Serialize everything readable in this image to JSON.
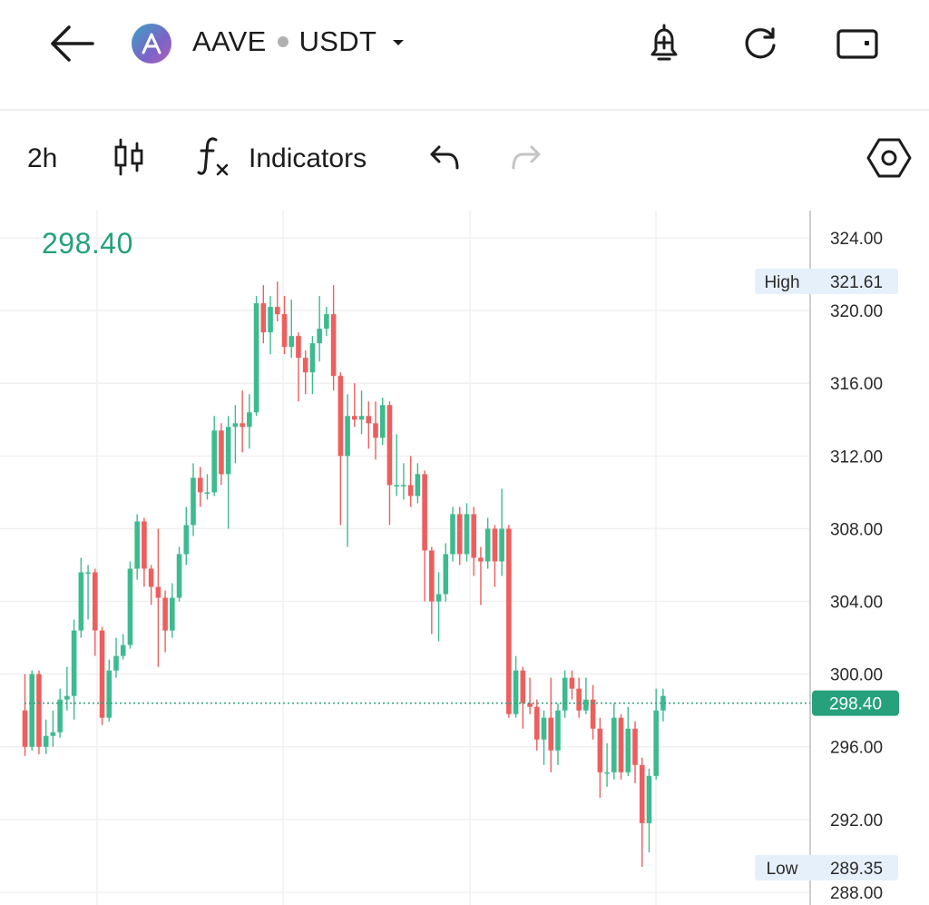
{
  "header": {
    "base": "AAVE",
    "quote": "USDT",
    "icons": [
      "back-arrow-icon",
      "aave-logo-icon",
      "caret-down-icon",
      "price-alert-bell-icon",
      "refresh-icon",
      "wallet-icon"
    ]
  },
  "toolbar": {
    "timeframe": "2h",
    "indicators_label": "Indicators",
    "icons": [
      "candlestick-type-icon",
      "fx-indicators-icon",
      "undo-icon",
      "redo-icon",
      "settings-hexagon-icon"
    ]
  },
  "last_price": "298.40",
  "colors": {
    "up": "#3dbb8f",
    "down": "#ee5e5e",
    "accent": "#26a17b",
    "badge_bg": "#e6f0fb"
  },
  "chart_data": {
    "type": "candlestick",
    "yticks": [
      "324.00",
      "320.00",
      "316.00",
      "312.00",
      "308.00",
      "304.00",
      "300.00",
      "296.00",
      "292.00",
      "288.00"
    ],
    "ylim": [
      286.4,
      324.6
    ],
    "grid": true,
    "high": {
      "label": "High",
      "value": "321.61"
    },
    "low": {
      "label": "Low",
      "value": "289.35"
    },
    "last": {
      "value": "298.40"
    },
    "candles": [
      [
        298.0,
        296.0,
        300.0,
        295.5
      ],
      [
        296.0,
        300.0,
        300.2,
        295.8
      ],
      [
        300.0,
        296.0,
        300.2,
        295.6
      ],
      [
        296.0,
        296.6,
        297.5,
        295.6
      ],
      [
        296.6,
        296.8,
        298.0,
        296.0
      ],
      [
        296.8,
        298.6,
        299.2,
        296.5
      ],
      [
        298.6,
        298.8,
        300.4,
        298.0
      ],
      [
        298.8,
        302.4,
        303.0,
        297.5
      ],
      [
        302.4,
        305.6,
        306.4,
        302.0
      ],
      [
        305.6,
        305.6,
        306.0,
        303.0
      ],
      [
        305.6,
        302.4,
        305.8,
        301.0
      ],
      [
        302.4,
        297.6,
        302.6,
        297.2
      ],
      [
        297.6,
        300.2,
        300.8,
        297.4
      ],
      [
        300.2,
        301.0,
        302.0,
        299.8
      ],
      [
        301.0,
        301.6,
        302.2,
        300.8
      ],
      [
        301.6,
        305.8,
        306.2,
        301.4
      ],
      [
        305.8,
        308.4,
        308.8,
        305.2
      ],
      [
        308.4,
        305.8,
        308.6,
        304.8
      ],
      [
        305.8,
        304.8,
        306.0,
        303.8
      ],
      [
        304.8,
        304.2,
        308.0,
        300.4
      ],
      [
        304.2,
        302.4,
        304.6,
        301.2
      ],
      [
        302.4,
        304.2,
        305.0,
        302.0
      ],
      [
        304.2,
        306.6,
        307.0,
        304.0
      ],
      [
        306.6,
        308.2,
        309.2,
        306.0
      ],
      [
        308.2,
        310.8,
        311.6,
        307.6
      ],
      [
        310.8,
        310.0,
        311.4,
        309.2
      ],
      [
        310.0,
        310.0,
        311.0,
        309.6
      ],
      [
        310.0,
        313.4,
        314.2,
        309.8
      ],
      [
        313.4,
        311.0,
        313.8,
        310.4
      ],
      [
        311.0,
        313.6,
        314.2,
        308.0
      ],
      [
        313.6,
        313.8,
        314.8,
        311.6
      ],
      [
        313.8,
        313.6,
        315.6,
        312.2
      ],
      [
        313.6,
        314.4,
        315.4,
        312.4
      ],
      [
        314.4,
        320.4,
        320.8,
        314.2
      ],
      [
        320.4,
        318.8,
        321.4,
        318.2
      ],
      [
        318.8,
        320.2,
        320.8,
        317.6
      ],
      [
        320.2,
        319.8,
        321.6,
        319.4
      ],
      [
        319.8,
        318.0,
        320.8,
        317.6
      ],
      [
        318.0,
        318.6,
        320.6,
        317.4
      ],
      [
        318.6,
        317.4,
        318.8,
        315.0
      ],
      [
        317.4,
        316.6,
        317.8,
        315.4
      ],
      [
        316.6,
        318.2,
        318.6,
        315.4
      ],
      [
        318.2,
        319.0,
        320.8,
        317.2
      ],
      [
        319.0,
        319.8,
        320.2,
        318.6
      ],
      [
        319.8,
        316.4,
        321.4,
        315.6
      ],
      [
        316.4,
        312.0,
        316.6,
        308.2
      ],
      [
        312.0,
        314.2,
        315.4,
        307.0
      ],
      [
        314.2,
        314.0,
        316.0,
        313.6
      ],
      [
        314.0,
        314.2,
        315.6,
        313.2
      ],
      [
        314.2,
        313.8,
        315.0,
        312.4
      ],
      [
        313.8,
        313.0,
        315.0,
        311.8
      ],
      [
        313.0,
        314.8,
        315.2,
        312.6
      ],
      [
        314.8,
        310.4,
        315.0,
        308.2
      ],
      [
        310.4,
        310.4,
        313.2,
        309.8
      ],
      [
        310.4,
        310.4,
        311.6,
        309.6
      ],
      [
        310.4,
        309.8,
        312.0,
        309.2
      ],
      [
        309.8,
        311.0,
        311.6,
        309.4
      ],
      [
        311.0,
        306.8,
        311.2,
        304.0
      ],
      [
        306.8,
        304.0,
        307.0,
        302.2
      ],
      [
        304.0,
        304.4,
        305.6,
        301.8
      ],
      [
        304.4,
        306.6,
        307.2,
        304.0
      ],
      [
        306.6,
        308.8,
        309.2,
        306.2
      ],
      [
        308.8,
        306.6,
        309.2,
        306.0
      ],
      [
        306.6,
        308.8,
        309.4,
        306.2
      ],
      [
        308.8,
        306.4,
        309.2,
        305.4
      ],
      [
        306.4,
        306.2,
        307.0,
        303.8
      ],
      [
        306.2,
        308.0,
        308.6,
        305.8
      ],
      [
        308.0,
        306.2,
        308.2,
        304.8
      ],
      [
        306.2,
        308.0,
        310.2,
        305.4
      ],
      [
        308.0,
        297.8,
        308.2,
        297.6
      ],
      [
        297.8,
        300.2,
        301.0,
        297.6
      ],
      [
        300.2,
        298.4,
        300.4,
        297.0
      ],
      [
        298.4,
        298.2,
        299.8,
        297.8
      ],
      [
        298.2,
        296.4,
        298.6,
        295.8
      ],
      [
        296.4,
        297.6,
        298.0,
        295.0
      ],
      [
        297.6,
        295.8,
        299.8,
        294.6
      ],
      [
        295.8,
        298.0,
        298.4,
        295.0
      ],
      [
        298.0,
        299.8,
        300.2,
        297.6
      ],
      [
        299.8,
        299.2,
        300.2,
        298.6
      ],
      [
        299.2,
        298.0,
        299.8,
        297.6
      ],
      [
        298.0,
        298.6,
        299.8,
        297.8
      ],
      [
        298.6,
        297.0,
        299.4,
        296.4
      ],
      [
        297.0,
        294.6,
        297.6,
        293.2
      ],
      [
        294.6,
        294.6,
        296.2,
        293.8
      ],
      [
        294.6,
        297.6,
        298.4,
        294.2
      ],
      [
        297.6,
        294.6,
        297.8,
        294.2
      ],
      [
        294.6,
        297.0,
        298.2,
        294.4
      ],
      [
        297.0,
        295.0,
        297.4,
        294.0
      ],
      [
        295.0,
        291.8,
        295.4,
        289.4
      ],
      [
        291.8,
        294.4,
        294.8,
        290.2
      ],
      [
        294.4,
        298.0,
        299.2,
        294.2
      ],
      [
        298.0,
        298.8,
        299.2,
        297.4
      ]
    ]
  }
}
